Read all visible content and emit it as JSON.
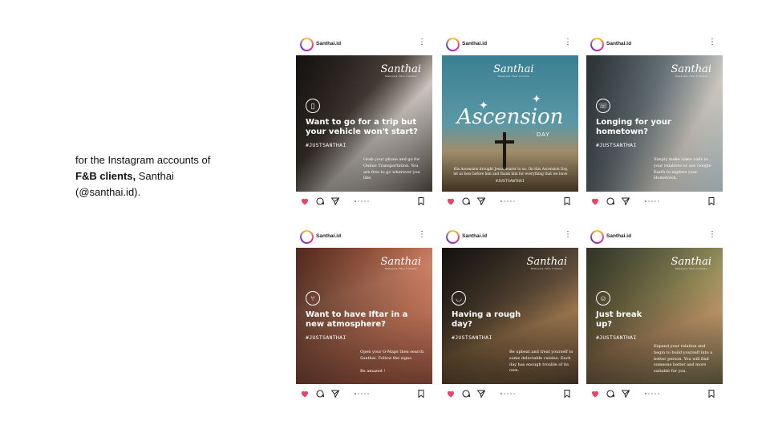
{
  "caption": {
    "line_start": "for the Instagram accounts of",
    "bold": "F&B clients,",
    "line_end": " Santhai (@santhai.id)."
  },
  "account_name": "Santhai.id",
  "brand": {
    "logo": "Santhai",
    "logo_sub": "Malaysia Thai Cuisine",
    "hashtag": "#JUSTSANTHAI"
  },
  "icons": {
    "more": "more-vertical-icon",
    "like": "heart-icon",
    "comment": "comment-icon",
    "share": "send-icon",
    "save": "bookmark-icon"
  },
  "colors": {
    "heart": "#ee4266",
    "carousel_active": "#3b82f6"
  },
  "posts": [
    {
      "headline": "Want to go for a trip but your vehicle won't start?",
      "body": "Grab your phone and go for Online Transportation. You are free to go wherever you like."
    },
    {
      "title": "Ascension",
      "subtitle": "DAY",
      "body": "His Ascension brought Jesus nearer to us. On this Ascension Day, let us bow before him and thank him for everything that we have."
    },
    {
      "headline": "Longing for your hometown?",
      "body": "Simply make video calls to your relatives or use Google Earth to explore your Hometown."
    },
    {
      "headline": "Want to have Iftar in a new atmosphere?",
      "body": "Open your G-Maps then search Santhai. Follow the signs.",
      "note": "Be amazed !"
    },
    {
      "headline": "Having a rough day?",
      "body": "Be upbeat and treat yourself to some delectable cuisine. Each day has enough trouble of its own."
    },
    {
      "headline": "Just break up?",
      "body": "Expand your relation and begin to build yourself into a better person. You will find someone better and more suitable for you."
    }
  ]
}
